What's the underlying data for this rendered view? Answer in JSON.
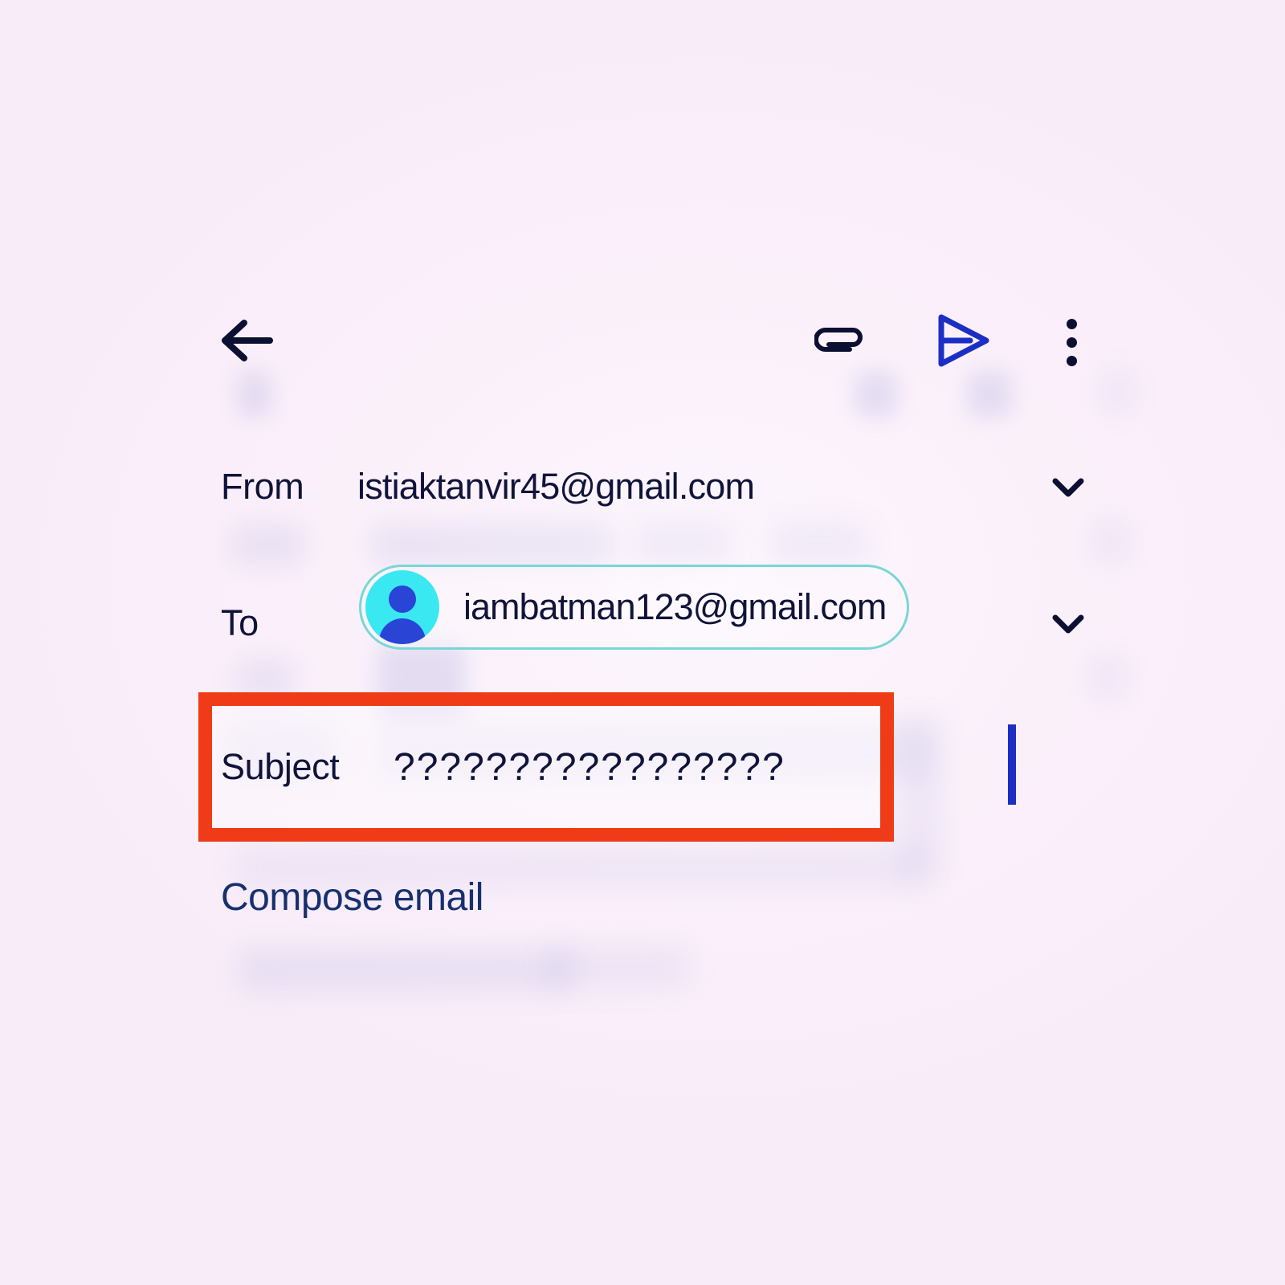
{
  "app": {
    "background_color": "#faeffa",
    "text_color": "#10143a",
    "accent_blue": "#1b2fc4",
    "highlight_color": "#f03b18",
    "chip_border_color": "#7ad6d6",
    "avatar_bg_color": "#3ae8f2",
    "avatar_fg_color": "#2a44d6",
    "body_text_color": "#17306e"
  },
  "toolbar": {
    "back_label": "back-arrow",
    "attach_label": "attach-file",
    "send_label": "send",
    "more_label": "more-options",
    "icons": {
      "back": "arrow-left-icon",
      "attach": "paperclip-icon",
      "send": "send-icon",
      "more": "more-vertical-icon"
    }
  },
  "fields": {
    "from": {
      "label": "From",
      "value": "istiaktanvir45@gmail.com",
      "expand_icon": "chevron-down-icon"
    },
    "to": {
      "label": "To",
      "recipient": "iambatman123@gmail.com",
      "avatar_icon": "person-icon",
      "expand_icon": "chevron-down-icon"
    },
    "subject": {
      "label": "Subject",
      "value": "?????????????????",
      "placeholder": "Subject",
      "highlighted": "true"
    }
  },
  "body": {
    "placeholder": "Compose email"
  }
}
